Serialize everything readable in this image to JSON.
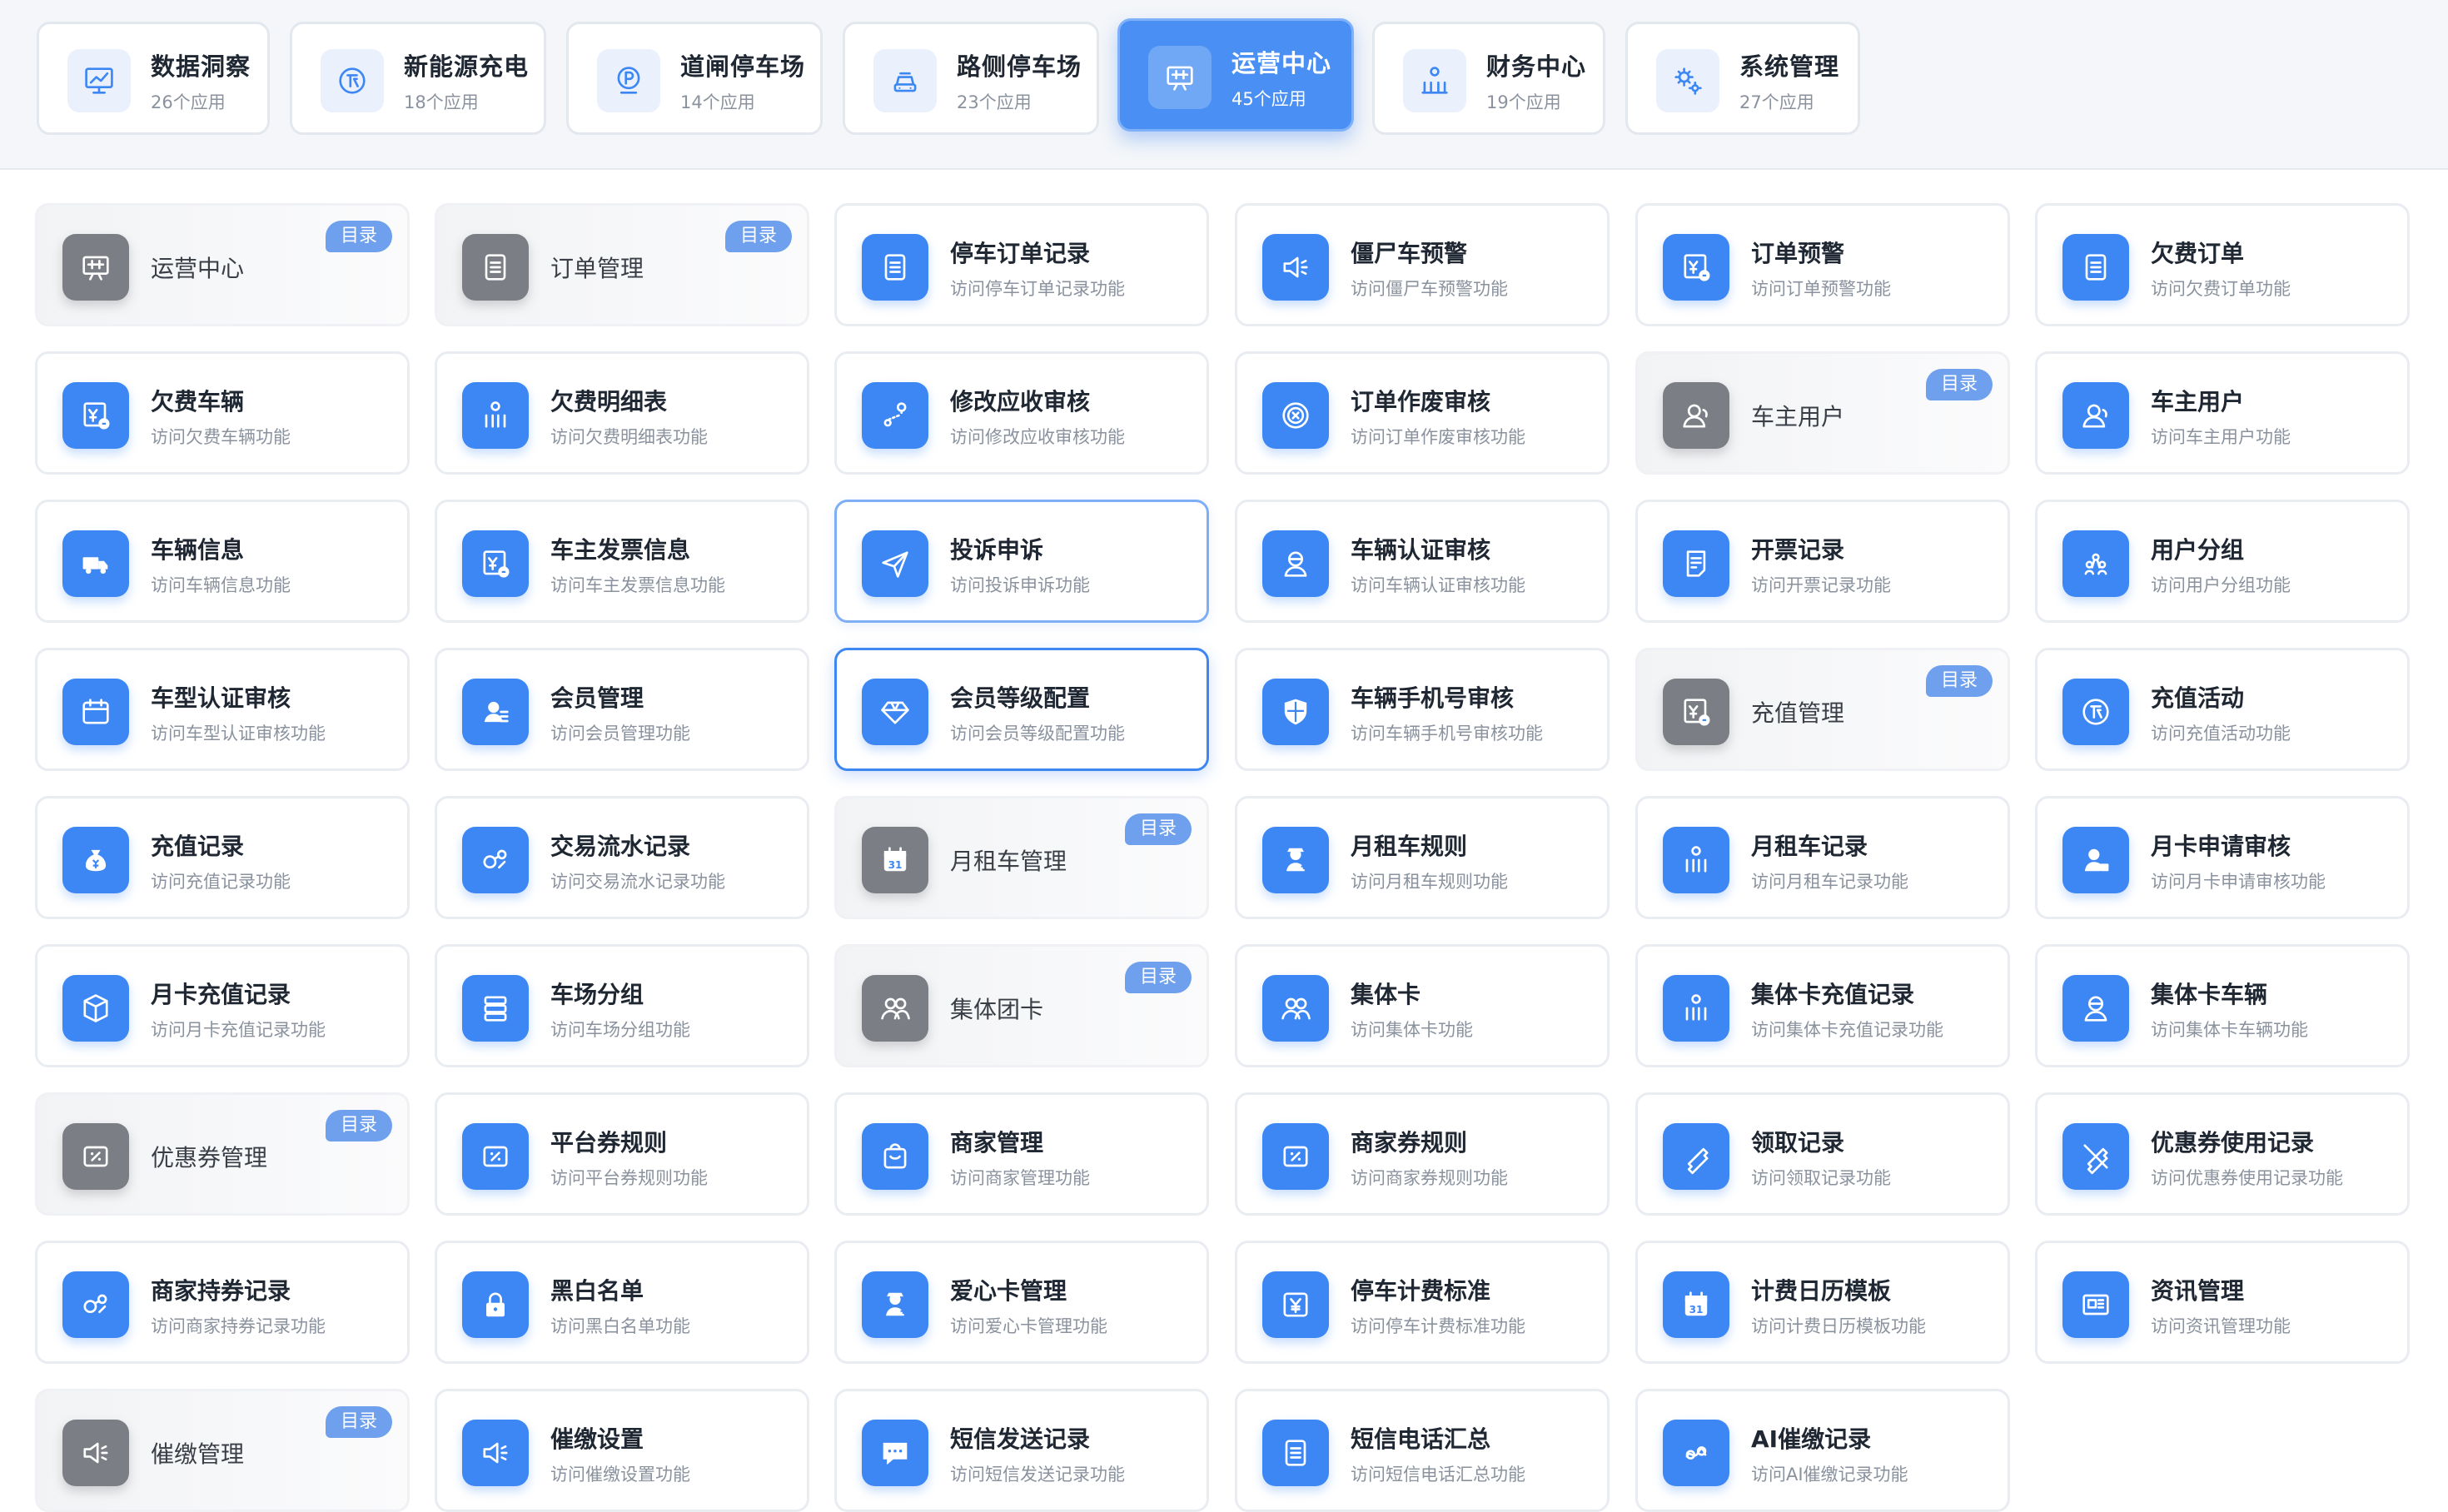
{
  "categories": [
    {
      "title": "数据洞察",
      "count": "26个应用",
      "icon": "chart-icon"
    },
    {
      "title": "新能源充电",
      "count": "18个应用",
      "icon": "charge-icon"
    },
    {
      "title": "道闸停车场",
      "count": "14个应用",
      "icon": "parking-icon"
    },
    {
      "title": "路侧停车场",
      "count": "23个应用",
      "icon": "car-icon"
    },
    {
      "title": "运营中心",
      "count": "45个应用",
      "icon": "board-icon",
      "active": true
    },
    {
      "title": "财务中心",
      "count": "19个应用",
      "icon": "finance-icon"
    },
    {
      "title": "系统管理",
      "count": "27个应用",
      "icon": "gear-icon"
    }
  ],
  "badge_label": "目录",
  "apps": [
    {
      "title": "运营中心",
      "dir": true,
      "icon": "board-icon"
    },
    {
      "title": "订单管理",
      "dir": true,
      "icon": "doc-icon"
    },
    {
      "title": "停车订单记录",
      "sub": "访问停车订单记录功能",
      "icon": "doc-icon"
    },
    {
      "title": "僵尸车预警",
      "sub": "访问僵尸车预警功能",
      "icon": "speaker-icon"
    },
    {
      "title": "订单预警",
      "sub": "访问订单预警功能",
      "icon": "invoice-icon"
    },
    {
      "title": "欠费订单",
      "sub": "访问欠费订单功能",
      "icon": "doc-icon"
    },
    {
      "title": "欠费车辆",
      "sub": "访问欠费车辆功能",
      "icon": "invoice-icon"
    },
    {
      "title": "欠费明细表",
      "sub": "访问欠费明细表功能",
      "icon": "bars-icon"
    },
    {
      "title": "修改应收审核",
      "sub": "访问修改应收审核功能",
      "icon": "route-icon"
    },
    {
      "title": "订单作废审核",
      "sub": "访问订单作废审核功能",
      "icon": "cancel-icon"
    },
    {
      "title": "车主用户",
      "dir": true,
      "icon": "user-icon"
    },
    {
      "title": "车主用户",
      "sub": "访问车主用户功能",
      "icon": "user-icon"
    },
    {
      "title": "车辆信息",
      "sub": "访问车辆信息功能",
      "icon": "truck-icon"
    },
    {
      "title": "车主发票信息",
      "sub": "访问车主发票信息功能",
      "icon": "invoice-icon"
    },
    {
      "title": "投诉申诉",
      "sub": "访问投诉申诉功能",
      "icon": "send-icon",
      "sel": 1
    },
    {
      "title": "车辆认证审核",
      "sub": "访问车辆认证审核功能",
      "icon": "person-icon"
    },
    {
      "title": "开票记录",
      "sub": "访问开票记录功能",
      "icon": "note-icon"
    },
    {
      "title": "用户分组",
      "sub": "访问用户分组功能",
      "icon": "group-icon"
    },
    {
      "title": "车型认证审核",
      "sub": "访问车型认证审核功能",
      "icon": "calendar-icon"
    },
    {
      "title": "会员管理",
      "sub": "访问会员管理功能",
      "icon": "member-icon"
    },
    {
      "title": "会员等级配置",
      "sub": "访问会员等级配置功能",
      "icon": "diamond-icon",
      "sel": 2
    },
    {
      "title": "车辆手机号审核",
      "sub": "访问车辆手机号审核功能",
      "icon": "shield-icon"
    },
    {
      "title": "充值管理",
      "dir": true,
      "icon": "invoice-icon"
    },
    {
      "title": "充值活动",
      "sub": "访问充值活动功能",
      "icon": "charge-icon"
    },
    {
      "title": "充值记录",
      "sub": "访问充值记录功能",
      "icon": "moneybag-icon"
    },
    {
      "title": "交易流水记录",
      "sub": "访问交易流水记录功能",
      "icon": "exchange-icon"
    },
    {
      "title": "月租车管理",
      "dir": true,
      "icon": "calendar31-icon"
    },
    {
      "title": "月租车规则",
      "sub": "访问月租车规则功能",
      "icon": "agent-icon"
    },
    {
      "title": "月租车记录",
      "sub": "访问月租车记录功能",
      "icon": "bars-icon"
    },
    {
      "title": "月卡申请审核",
      "sub": "访问月卡申请审核功能",
      "icon": "userlock-icon"
    },
    {
      "title": "月卡充值记录",
      "sub": "访问月卡充值记录功能",
      "icon": "box-icon"
    },
    {
      "title": "车场分组",
      "sub": "访问车场分组功能",
      "icon": "stack-icon"
    },
    {
      "title": "集体团卡",
      "dir": true,
      "icon": "users-icon"
    },
    {
      "title": "集体卡",
      "sub": "访问集体卡功能",
      "icon": "users-icon"
    },
    {
      "title": "集体卡充值记录",
      "sub": "访问集体卡充值记录功能",
      "icon": "bars-icon"
    },
    {
      "title": "集体卡车辆",
      "sub": "访问集体卡车辆功能",
      "icon": "person-icon"
    },
    {
      "title": "优惠券管理",
      "dir": true,
      "icon": "coupon-icon"
    },
    {
      "title": "平台券规则",
      "sub": "访问平台券规则功能",
      "icon": "coupon-icon"
    },
    {
      "title": "商家管理",
      "sub": "访问商家管理功能",
      "icon": "bag-icon"
    },
    {
      "title": "商家券规则",
      "sub": "访问商家券规则功能",
      "icon": "coupon-icon"
    },
    {
      "title": "领取记录",
      "sub": "访问领取记录功能",
      "icon": "ticket-icon"
    },
    {
      "title": "优惠券使用记录",
      "sub": "访问优惠券使用记录功能",
      "icon": "ticketx-icon"
    },
    {
      "title": "商家持券记录",
      "sub": "访问商家持券记录功能",
      "icon": "exchange-icon"
    },
    {
      "title": "黑白名单",
      "sub": "访问黑白名单功能",
      "icon": "lock-icon"
    },
    {
      "title": "爱心卡管理",
      "sub": "访问爱心卡管理功能",
      "icon": "agent-icon"
    },
    {
      "title": "停车计费标准",
      "sub": "访问停车计费标准功能",
      "icon": "yen-icon"
    },
    {
      "title": "计费日历模板",
      "sub": "访问计费日历模板功能",
      "icon": "calendar31-icon"
    },
    {
      "title": "资讯管理",
      "sub": "访问资讯管理功能",
      "icon": "news-icon"
    },
    {
      "title": "催缴管理",
      "dir": true,
      "icon": "speaker-icon"
    },
    {
      "title": "催缴设置",
      "sub": "访问催缴设置功能",
      "icon": "speaker-icon"
    },
    {
      "title": "短信发送记录",
      "sub": "访问短信发送记录功能",
      "icon": "chat-icon"
    },
    {
      "title": "短信电话汇总",
      "sub": "访问短信电话汇总功能",
      "icon": "doc-icon"
    },
    {
      "title": "AI催缴记录",
      "sub": "访问AI催缴记录功能",
      "icon": "ai-icon"
    }
  ],
  "colors": {
    "accent": "#3d87f4",
    "active_tab": "#4a90f4",
    "dir_icon": "#7b7e84",
    "badge": "#6fa0ee"
  }
}
